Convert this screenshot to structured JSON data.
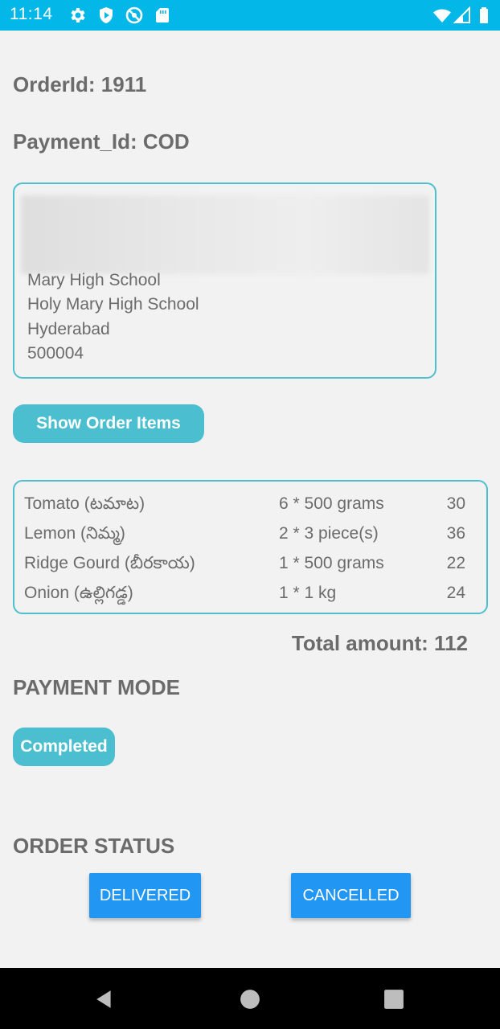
{
  "status_bar": {
    "time": "11:14",
    "left_icons": [
      "gear-icon",
      "shield-play-icon",
      "no-entry-icon",
      "sd-card-icon"
    ],
    "right_icons": [
      "wifi-icon",
      "signal-icon",
      "battery-icon"
    ]
  },
  "order": {
    "order_id": "OrderId: 1911",
    "payment_id": "Payment_Id: COD"
  },
  "address": {
    "lines": [
      "Mary High School",
      "Holy Mary High School",
      "Hyderabad",
      "500004"
    ]
  },
  "show_items_button": "Show Order Items",
  "items": [
    {
      "name": "Tomato (టమాట)",
      "qty": "6 * 500 grams",
      "price": "30"
    },
    {
      "name": "Lemon (నిమ్మ)",
      "qty": "2 * 3 piece(s)",
      "price": "36"
    },
    {
      "name": "Ridge Gourd (బీరకాయ)",
      "qty": "1 * 500 grams",
      "price": "22"
    },
    {
      "name": "Onion (ఉల్లిగడ్డ)",
      "qty": "1 * 1 kg",
      "price": "24"
    }
  ],
  "total": "Total amount: 112",
  "payment_mode": {
    "heading": "PAYMENT MODE",
    "status": "Completed"
  },
  "order_status": {
    "heading": "ORDER STATUS",
    "delivered_label": "DELIVERED",
    "cancelled_label": "CANCELLED"
  },
  "colors": {
    "status_bar": "#03b7e8",
    "accent_teal": "#4bbfcf",
    "button_blue": "#2196f3",
    "text_gray": "#6b6b6b",
    "background": "#f2f2f2"
  }
}
